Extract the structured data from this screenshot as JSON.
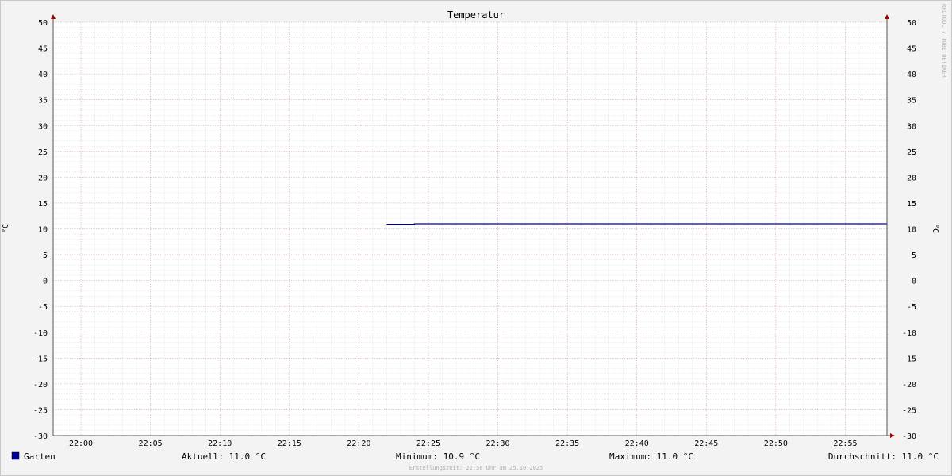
{
  "chart_data": {
    "type": "line",
    "title": "Temperatur",
    "ylabel": "°C",
    "ylim": [
      -30,
      50
    ],
    "y_ticks": [
      50,
      45,
      40,
      35,
      30,
      25,
      20,
      15,
      10,
      5,
      0,
      -5,
      -10,
      -15,
      -20,
      -25,
      -30
    ],
    "x_ticks": [
      "22:00",
      "22:05",
      "22:10",
      "22:15",
      "22:20",
      "22:25",
      "22:30",
      "22:35",
      "22:40",
      "22:45",
      "22:50",
      "22:55"
    ],
    "xlim": [
      "21:58",
      "22:58"
    ],
    "grid": true,
    "series": [
      {
        "name": "Garten",
        "color": "#000099",
        "points": [
          {
            "x": "22:22",
            "y": 10.9
          },
          {
            "x": "22:24",
            "y": 10.9
          },
          {
            "x": "22:24",
            "y": 11.0
          },
          {
            "x": "22:58",
            "y": 11.0
          }
        ]
      }
    ]
  },
  "legend": {
    "series_name": "Garten",
    "swatch_color": "#000099",
    "current": "Aktuell: 11.0 °C",
    "minimum": "Minimum: 10.9 °C",
    "maximum": "Maximum: 11.0 °C",
    "average": "Durchschnitt: 11.0 °C"
  },
  "footer": {
    "created": "Erstellungszeit: 22:58 Uhr am 25.10.2025"
  },
  "watermark": "RRDTOOL / TOBI OETIKER"
}
